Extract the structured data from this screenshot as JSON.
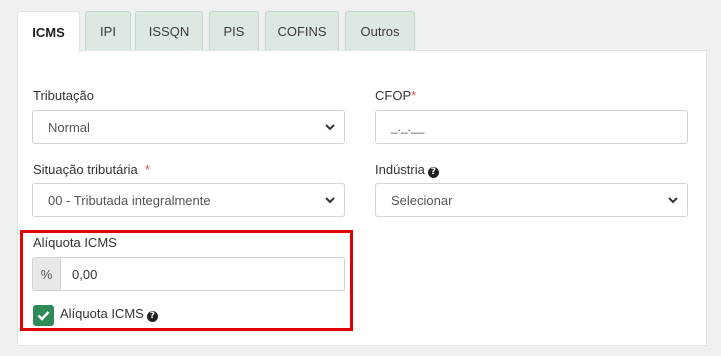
{
  "tabs": [
    {
      "label": "ICMS",
      "active": true
    },
    {
      "label": "IPI"
    },
    {
      "label": "ISSQN"
    },
    {
      "label": "PIS"
    },
    {
      "label": "COFINS"
    },
    {
      "label": "Outros"
    }
  ],
  "form": {
    "tributacao": {
      "label": "Tributação",
      "value": "Normal"
    },
    "cfop": {
      "label": "CFOP",
      "required_mark": "*",
      "value": "_._.__"
    },
    "situacao": {
      "label": "Situação tributária",
      "required_mark": "*",
      "value": "00 - Tributada integralmente"
    },
    "industria": {
      "label": "Indústria",
      "help_icon": "question-circle-icon",
      "value": "Selecionar"
    },
    "aliquota": {
      "label": "Alíquota ICMS",
      "addon": "%",
      "value": "0,00"
    },
    "aliquota_check": {
      "label": "Alíquota ICMS",
      "checked": true,
      "help_icon": "question-circle-icon"
    }
  },
  "colors": {
    "accent": "#2e8b57",
    "highlight": "#e00000",
    "required": "#d9534f",
    "tab_bg": "#dce9e1"
  }
}
